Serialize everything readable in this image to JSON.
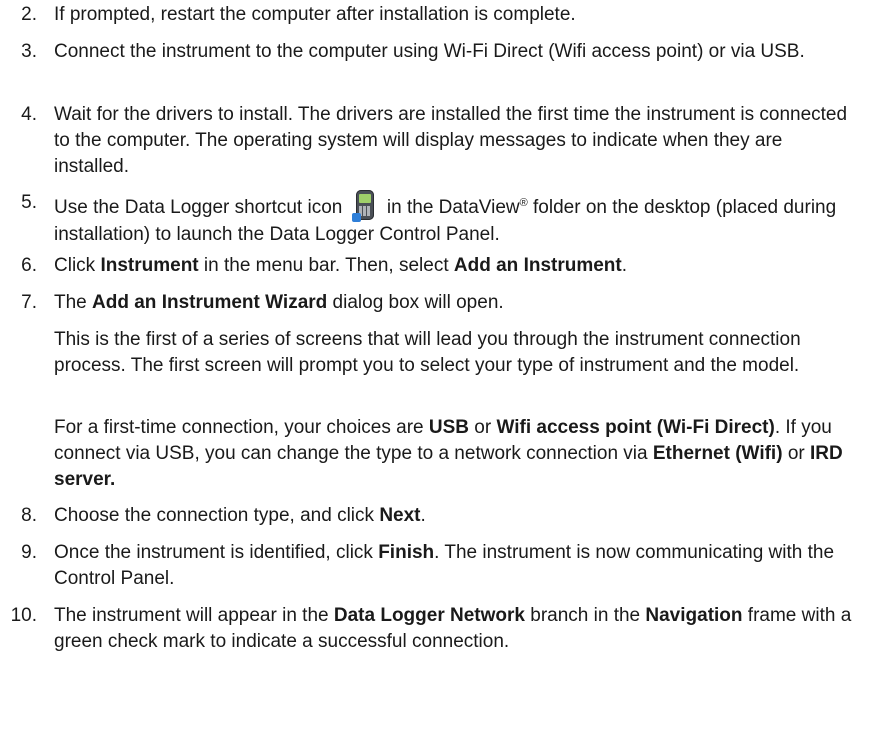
{
  "steps": [
    {
      "num": "2.",
      "text": "If prompted, restart the computer after installation is complete."
    },
    {
      "num": "3.",
      "text": "Connect the instrument to the computer using Wi-Fi Direct (Wifi access point) or via USB."
    },
    {
      "num": "4.",
      "text": "Wait for the drivers to install. The drivers are installed the first time the instrument is connected to the computer. The operating system will display messages to indicate when they are installed."
    },
    {
      "num": "5.",
      "a": "Use the Data Logger shortcut icon",
      "b": "in the DataView",
      "reg": "®",
      "c": "folder on the desktop (placed during installation) to launch the Data Logger Control Panel.",
      "icon": "data-logger-shortcut-icon"
    },
    {
      "num": "6.",
      "a": "Click",
      "b1": "Instrument",
      "c": "in the menu bar. Then, select",
      "b2": "Add an Instrument",
      "d": "."
    },
    {
      "num": "7.",
      "a": "The",
      "b1": "Add an Instrument Wizard",
      "c": "dialog box will open."
    },
    {
      "num": "8.",
      "a": "Choose the connection type, and click",
      "b1": "Next",
      "d": "."
    },
    {
      "num": "9.",
      "a": "Once the instrument is identified, click",
      "b1": "Finish",
      "c": ". The instrument is now communicating with the Control Panel."
    },
    {
      "num": "10.",
      "a": "The instrument will appear in the",
      "b1": "Data Logger Network",
      "c": "branch in the",
      "b2": "Navigation",
      "d": "frame with a green check mark to indicate a successful connection."
    }
  ],
  "step7_paras": [
    {
      "text": "This is the first of a series of screens that will lead you through the instrument connection process. The first screen will prompt you to select your type of instrument and the model."
    },
    {
      "a": "For a first-time connection, your choices are",
      "b1": "USB",
      "c": "or",
      "b2": "Wifi access point (Wi-Fi Direct)",
      "d": ". If you connect via USB, you can change the type to a network connection via",
      "b3": "Ethernet (Wifi)",
      "e": "or",
      "b4": "IRD server."
    }
  ]
}
